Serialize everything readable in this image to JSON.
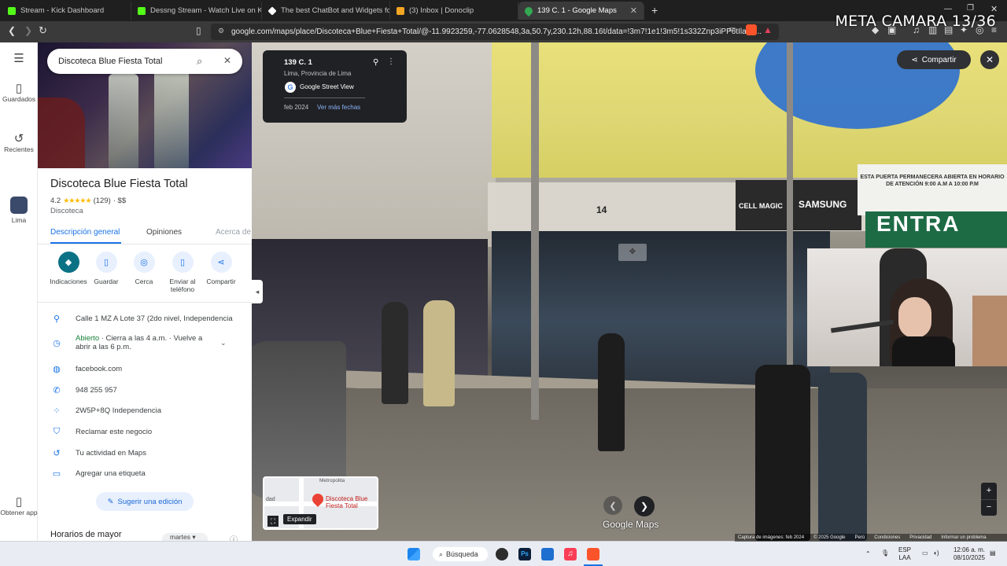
{
  "browser": {
    "tabs": [
      {
        "title": "Stream - Kick Dashboard",
        "color": "#53fc18",
        "active": false
      },
      {
        "title": "Dessng Stream - Watch Live on K",
        "color": "#53fc18",
        "active": false
      },
      {
        "title": "The best ChatBot and Widgets for Ki",
        "color": "#ffffff",
        "active": false
      },
      {
        "title": "(3) Inbox | Donoclip",
        "color": "#f5a623",
        "active": false
      },
      {
        "title": "139 C. 1 - Google Maps",
        "color": "#34a853",
        "active": true
      }
    ],
    "url": "google.com/maps/place/Discoteca+Blue+Fiesta+Total/@-11.9923259,-77.0628548,3a,50.7y,230.12h,88.16t/data=!3m7!1e1!3m5!1s332Znp3iPP6tIla69..."
  },
  "overlay": {
    "stream_title": "META CAMARA 13/36"
  },
  "rail": {
    "saved": "Guardados",
    "recent": "Recientes",
    "lima": "Lima",
    "get_app": "Obtener app"
  },
  "panel": {
    "search_value": "Discoteca Blue Fiesta Total",
    "place_name": "Discoteca Blue Fiesta Total",
    "rating": "4.2",
    "stars": "★★★★★",
    "reviews": "(129)",
    "price": "· $$",
    "category": "Discoteca",
    "tabs": [
      "Descripción general",
      "Opiniones",
      "Acerca de"
    ],
    "actions": [
      "Indicaciones",
      "Guardar",
      "Cerca",
      "Enviar al teléfono",
      "Compartir"
    ],
    "address": "Calle 1 MZ A Lote 37 (2do nivel, Independencia",
    "hours_status": "Abierto",
    "hours_detail": "· Cierra a las 4 a.m. · Vuelve a abrir a las 6 p.m.",
    "website": "facebook.com",
    "phone": "948 255 957",
    "plus_code": "2W5P+8Q Independencia",
    "claim": "Reclamar este negocio",
    "activity": "Tu actividad en Maps",
    "label": "Agregar una etiqueta",
    "suggest_edit": "Sugerir una edición",
    "popular_hours": "Horarios de mayor",
    "day": "martes"
  },
  "streetview": {
    "card_title": "139 C. 1",
    "card_location": "Lima, Provincia de Lima",
    "card_provider": "Google Street View",
    "card_date": "feb 2024",
    "card_more_dates": "Ver más fechas",
    "share": "Compartir",
    "building_number": "14",
    "sign_cell": "CELL MAGIC",
    "sign_samsung": "SAMSUNG",
    "sign_notice": "ESTA PUERTA PERMANECERA ABIERTA EN HORARIO DE ATENCIÓN 9:00 A.M A 10:00 P.M",
    "sign_green": "ENTRA",
    "logo": "Google Maps",
    "expand": "Expandir",
    "minimap_label": "Discoteca Blue Fiesta Total",
    "minimap_metro": "Metropolita",
    "minimap_side": "dad",
    "footer": [
      "Captura de imágenes: feb 2024",
      "© 2025 Google",
      "Perú",
      "Condiciones",
      "Privacidad",
      "Informar un problema"
    ]
  },
  "taskbar": {
    "search": "Búsqueda",
    "lang_top": "ESP",
    "lang_bottom": "LAA",
    "time": "12:06 a. m.",
    "date": "08/10/2025"
  }
}
